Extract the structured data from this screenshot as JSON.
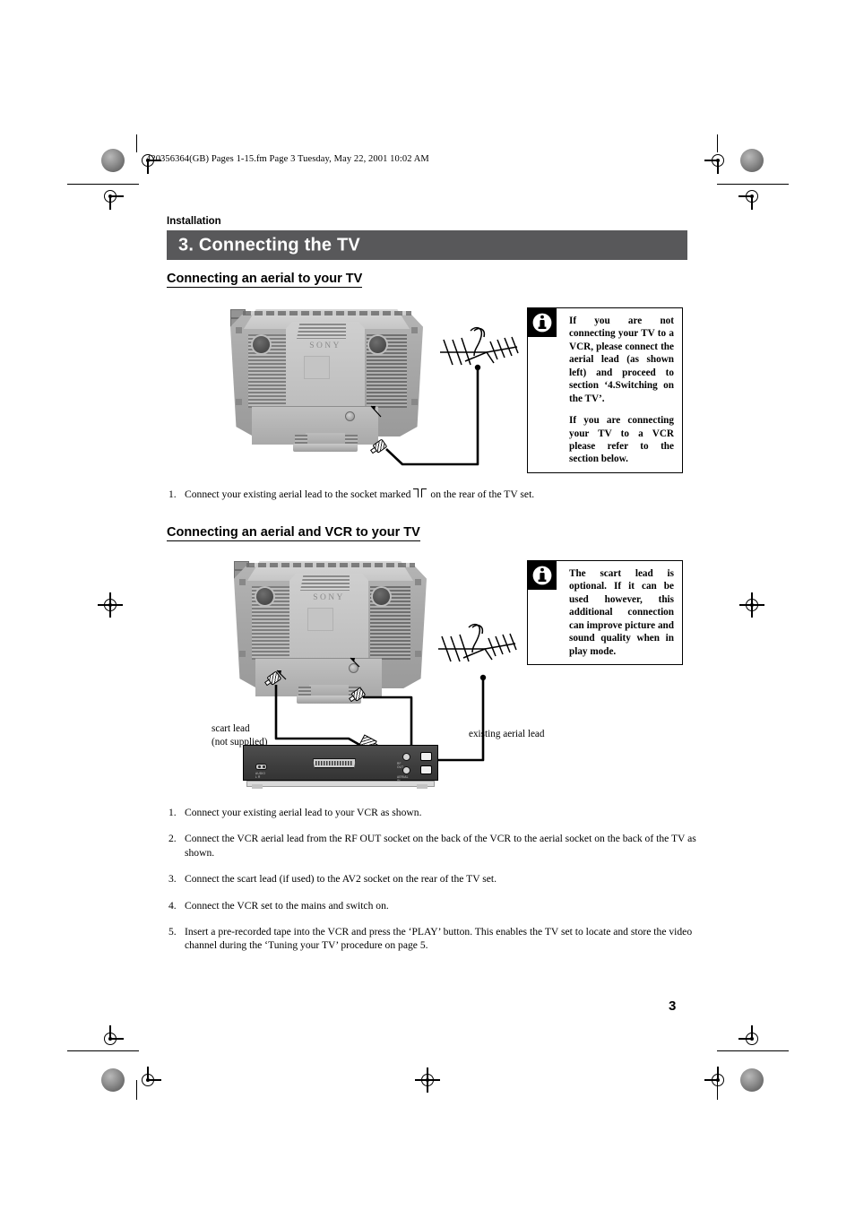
{
  "document": {
    "file_header": "420356364(GB) Pages 1-15.fm  Page 3  Tuesday, May 22, 2001  10:02 AM",
    "kicker": "Installation",
    "chapter_title": "3. Connecting the TV",
    "page_number": "3",
    "chapter_bar_color": "#58585a"
  },
  "sections": {
    "aerial": {
      "heading": "Connecting an aerial to your TV",
      "step": {
        "num": "1.",
        "text_before": "Connect your existing aerial lead to the socket marked",
        "text_after": "on the rear of the TV set.",
        "symbol_name": "aerial-socket-symbol"
      },
      "info": {
        "icon": "info-icon",
        "paragraphs": [
          "If you are not connecting your TV to a VCR, please connect the aerial lead (as shown left) and proceed to section ‘4.Switching on the TV’.",
          "If you are connecting your TV to a VCR please refer to the section below."
        ]
      },
      "figure": {
        "tv_brand": "SONY",
        "alt": "Rear view of Sony television with aerial lead connected to aerial socket"
      }
    },
    "aerial_vcr": {
      "heading": "Connecting an aerial and VCR to your TV",
      "info": {
        "icon": "info-icon",
        "paragraphs": [
          "The scart lead is optional. If it can be used however, this additional connection can improve picture and sound quality when in play mode."
        ]
      },
      "figure": {
        "tv_brand": "SONY",
        "labels": {
          "scart_lead_line1": "scart lead",
          "scart_lead_line2": "(not supplied)",
          "existing_aerial_lead": "existing aerial lead"
        },
        "alt": "Rear view of Sony television connected to a VCR with scart lead and aerial leads"
      },
      "steps": [
        {
          "num": "1.",
          "text": "Connect your existing aerial lead to your VCR as shown."
        },
        {
          "num": "2.",
          "text": "Connect the VCR aerial lead from the RF OUT socket on the back of the VCR to the aerial socket on the back of the TV as shown."
        },
        {
          "num": "3.",
          "text": "Connect the scart lead (if used) to the AV2 socket on the rear of the TV set."
        },
        {
          "num": "4.",
          "text": "Connect the VCR set to the mains and switch on."
        },
        {
          "num": "5.",
          "text": "Insert a pre-recorded tape into the VCR and press the ‘PLAY’ button. This enables the TV set to locate and store the video channel during the ‘Tuning your TV’ procedure on page 5."
        }
      ]
    }
  }
}
